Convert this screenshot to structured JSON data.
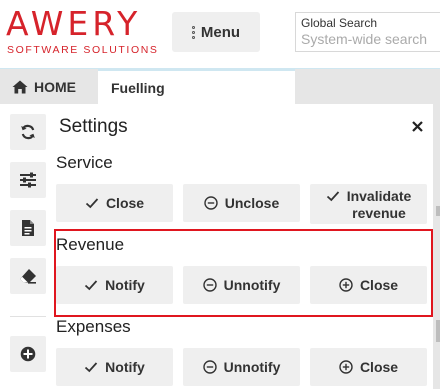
{
  "brand": {
    "name": "AWERY",
    "tagline": "SOFTWARE SOLUTIONS",
    "color": "#d6232b"
  },
  "header": {
    "menu_label": "Menu",
    "search": {
      "label": "Global Search",
      "placeholder": "System-wide search",
      "value": ""
    }
  },
  "tabs": {
    "home_label": "HOME",
    "active_tab_label": "Fuelling"
  },
  "toolbar": {
    "icons": [
      "refresh-icon",
      "sliders-icon",
      "document-icon",
      "eraser-icon",
      "add-circle-icon"
    ]
  },
  "settings": {
    "title": "Settings",
    "sections": {
      "service": {
        "title": "Service",
        "close": "Close",
        "unclose": "Unclose",
        "invalidate_line1": "Invalidate",
        "invalidate_line2": "revenue"
      },
      "revenue": {
        "title": "Revenue",
        "notify": "Notify",
        "unnotify": "Unnotify",
        "close": "Close"
      },
      "expenses": {
        "title": "Expenses",
        "notify": "Notify",
        "unnotify": "Unnotify",
        "close": "Close"
      }
    }
  },
  "colors": {
    "highlight_border": "#e0161f",
    "button_bg": "#efefef"
  }
}
